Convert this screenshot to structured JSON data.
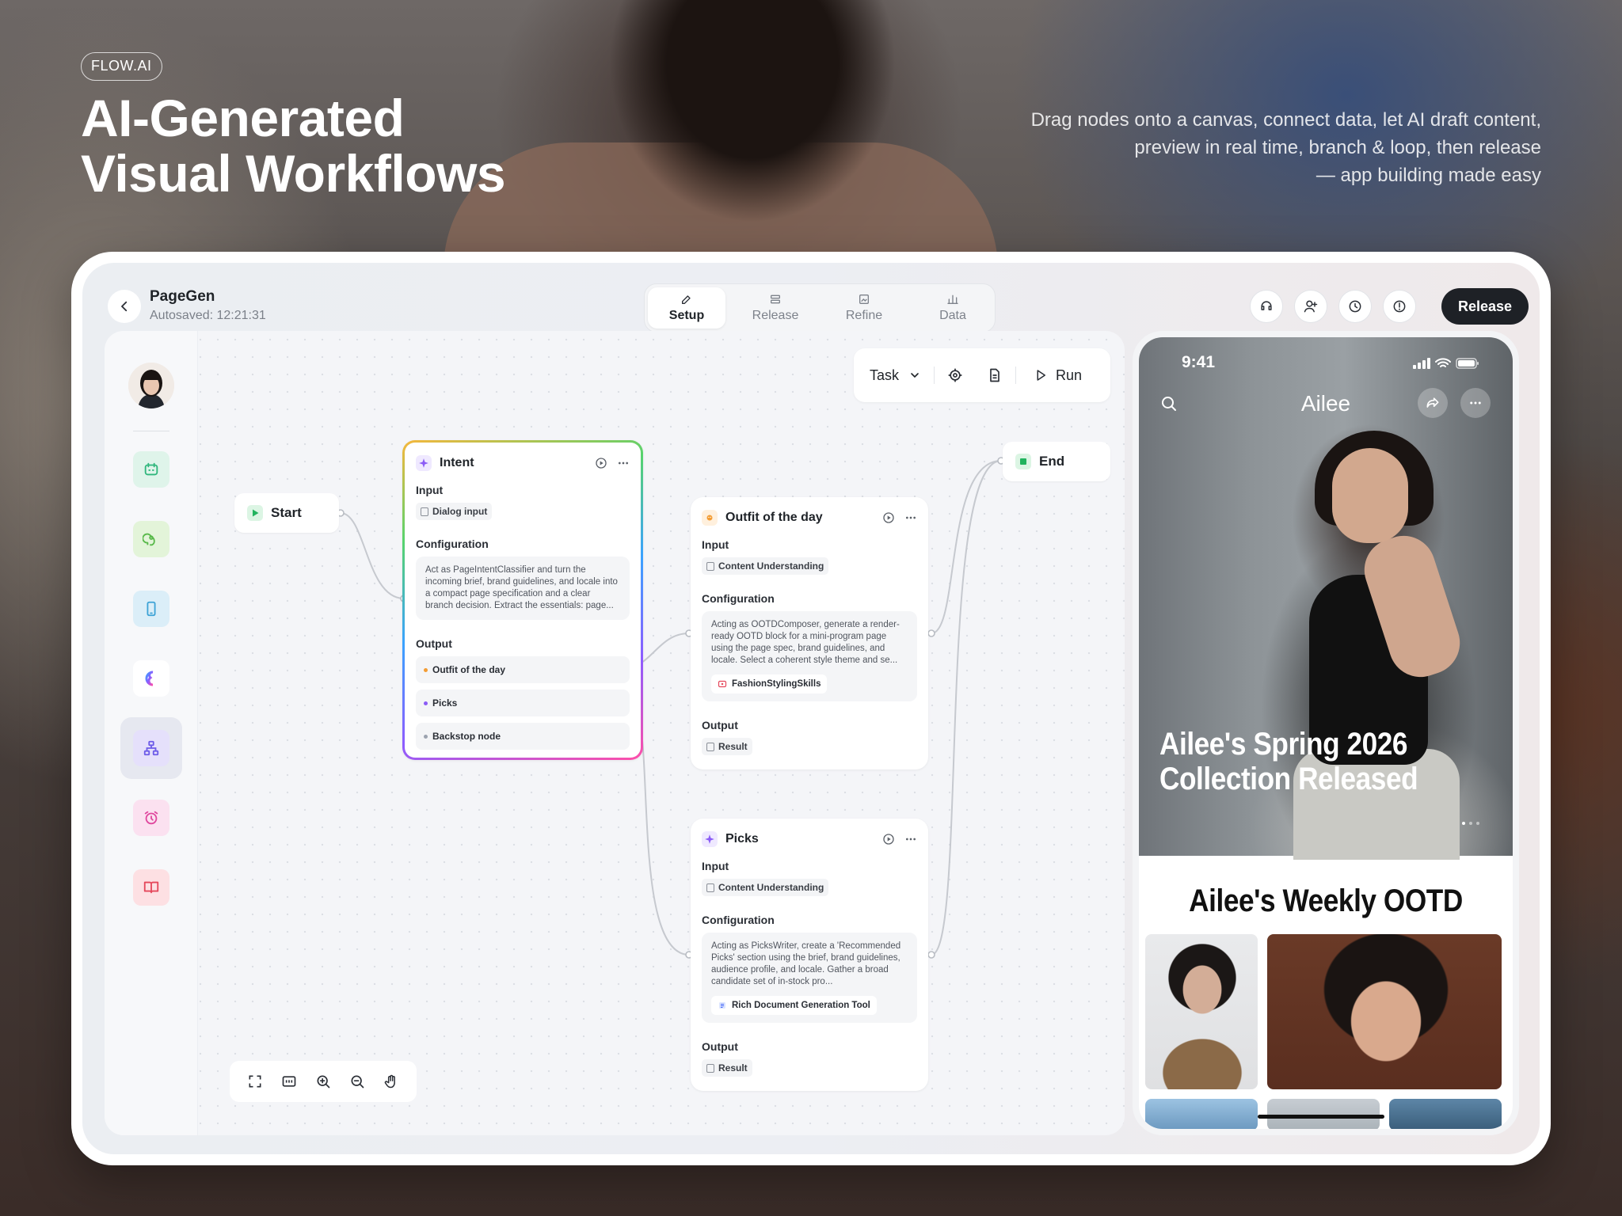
{
  "brand": "FLOW.AI",
  "hero": {
    "title_lines": [
      "AI-Generated",
      "Visual Workflows"
    ],
    "subtitle_lines": [
      "Drag nodes onto a canvas, connect data, let AI draft content,",
      "preview in real time, branch & loop, then release",
      "— app building made easy"
    ]
  },
  "header": {
    "app_name": "PageGen",
    "autosaved": "Autosaved: 12:21:31",
    "tabs": [
      {
        "label": "Setup",
        "icon": "edit-icon",
        "active": true
      },
      {
        "label": "Release",
        "icon": "grid-icon"
      },
      {
        "label": "Refine",
        "icon": "image-edit-icon"
      },
      {
        "label": "Data",
        "icon": "bar-chart-icon"
      }
    ],
    "action_icons": [
      "headset-icon",
      "add-user-icon",
      "history-icon",
      "info-icon"
    ],
    "release_label": "Release"
  },
  "sidebar": {
    "items": [
      {
        "name": "calendar-bot-icon",
        "color": "#2fb67c"
      },
      {
        "name": "brain-head-icon",
        "color": "#59b94a"
      },
      {
        "name": "mobile-icon",
        "color": "#3ea3d6"
      },
      {
        "name": "gradient-logo-icon",
        "color": "#6a5cff"
      },
      {
        "name": "workflow-tree-icon",
        "color": "#6d5ce8"
      },
      {
        "name": "alarm-clock-icon",
        "color": "#e0479e"
      },
      {
        "name": "book-icon",
        "color": "#e5485c"
      }
    ]
  },
  "toolbar": {
    "task_label": "Task",
    "run_label": "Run"
  },
  "canvas": {
    "start_label": "Start",
    "end_label": "End",
    "intent": {
      "title": "Intent",
      "input_label": "Input",
      "input_chip": "Dialog input",
      "config_label": "Configuration",
      "config_text": "Act as PageIntentClassifier and turn the incoming brief, brand guidelines, and locale into a compact page specification and a clear branch decision. Extract the essentials: page...",
      "output_label": "Output",
      "outputs": [
        {
          "label": "Outfit of the day",
          "color": "#f39c33"
        },
        {
          "label": "Picks",
          "color": "#8b5cf6"
        },
        {
          "label": "Backstop node",
          "color": "#9ca3af"
        }
      ]
    },
    "ootd": {
      "title": "Outfit of the day",
      "input_label": "Input",
      "input_chip": "Content Understanding",
      "config_label": "Configuration",
      "config_text": "Acting as OOTDComposer, generate a render-ready OOTD block for a mini-program page using the page spec, brand guidelines, and locale. Select a coherent style theme and se...",
      "skill": "FashionStylingSkills",
      "output_label": "Output",
      "output_chip": "Result"
    },
    "picks": {
      "title": "Picks",
      "input_label": "Input",
      "input_chip": "Content Understanding",
      "config_label": "Configuration",
      "config_text": "Acting as PicksWriter, create a 'Recommended Picks' section using the brief, brand guidelines, audience profile, and locale. Gather a broad candidate set of in-stock pro...",
      "skill": "Rich Document Generation Tool",
      "output_label": "Output",
      "output_chip": "Result"
    }
  },
  "preview": {
    "time": "9:41",
    "app_title": "Ailee",
    "headline_lines": [
      "Ailee's Spring 2026",
      "Collection Released"
    ],
    "section_title": "Ailee's Weekly OOTD"
  }
}
